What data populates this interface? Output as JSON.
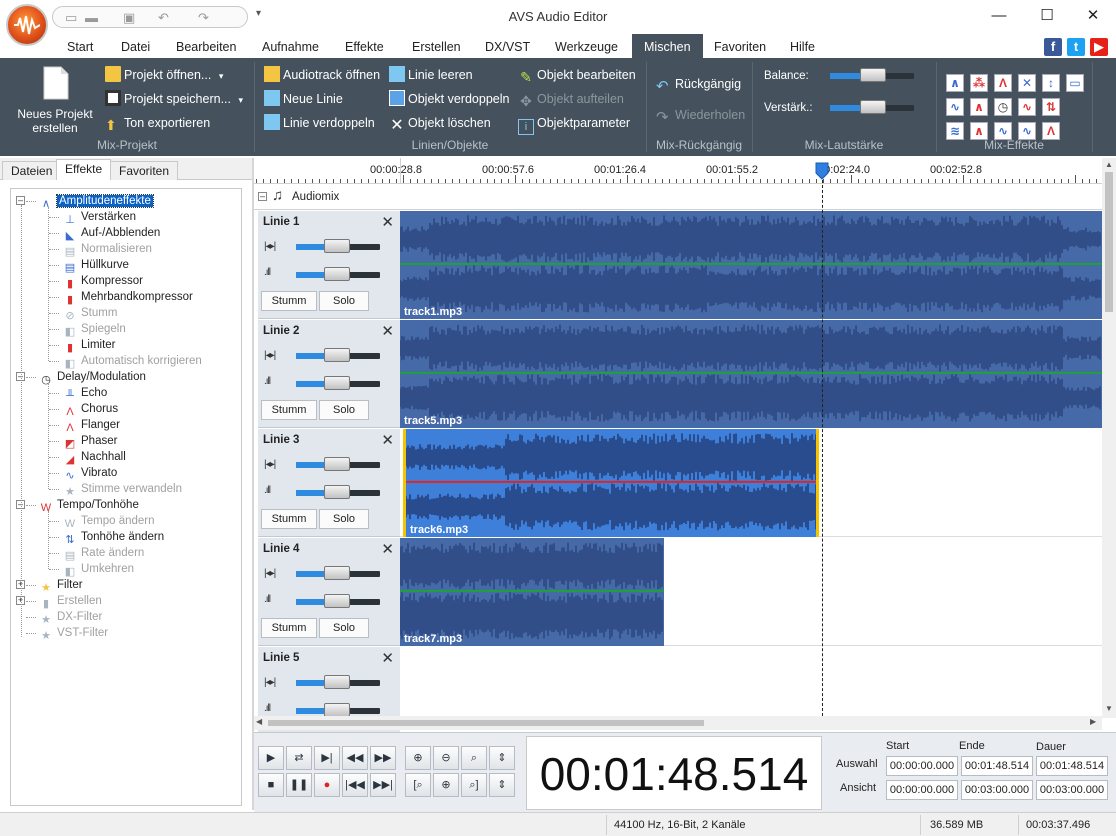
{
  "window": {
    "title": "AVS Audio Editor",
    "minimize": "—",
    "maximize": "☐",
    "close": "✕"
  },
  "menu": {
    "tabs": [
      "Start",
      "Datei",
      "Bearbeiten",
      "Aufnahme",
      "Effekte",
      "Erstellen",
      "DX/VST",
      "Werkzeuge",
      "Mischen",
      "Favoriten",
      "Hilfe"
    ],
    "active": "Mischen"
  },
  "ribbon": {
    "mix_projekt": {
      "label": "Mix-Projekt",
      "new_project": "Neues Projekt erstellen",
      "open_project": "Projekt öffnen...",
      "save_project": "Projekt speichern...",
      "export_sound": "Ton exportieren"
    },
    "lines_objects": {
      "label": "Linien/Objekte",
      "open_audiotrack": "Audiotrack öffnen",
      "new_line": "Neue Linie",
      "duplicate_line": "Linie verdoppeln",
      "clear_line": "Linie leeren",
      "duplicate_object": "Objekt verdoppeln",
      "delete_object": "Objekt löschen",
      "edit_object": "Objekt bearbeiten",
      "split_object": "Objekt aufteilen",
      "object_params": "Objektparameter"
    },
    "mix_undo": {
      "label": "Mix-Rückgängig",
      "undo": "Rückgängig",
      "redo": "Wiederholen"
    },
    "mix_volume": {
      "label": "Mix-Lautstärke",
      "balance": "Balance:",
      "gain": "Verstärk.:"
    },
    "mix_effects": {
      "label": "Mix-Effekte"
    }
  },
  "left_panel": {
    "tabs": [
      "Dateien",
      "Effekte",
      "Favoriten"
    ],
    "active_tab": "Effekte",
    "tree": [
      {
        "label": "Amplitudeneffekte",
        "level": 0,
        "expanded": true,
        "selected": true,
        "disabled": false
      },
      {
        "label": "Verstärken",
        "level": 1,
        "disabled": false
      },
      {
        "label": "Auf-/Abblenden",
        "level": 1,
        "disabled": false
      },
      {
        "label": "Normalisieren",
        "level": 1,
        "disabled": true
      },
      {
        "label": "Hüllkurve",
        "level": 1,
        "disabled": false
      },
      {
        "label": "Kompressor",
        "level": 1,
        "disabled": false
      },
      {
        "label": "Mehrbandkompressor",
        "level": 1,
        "disabled": false
      },
      {
        "label": "Stumm",
        "level": 1,
        "disabled": true
      },
      {
        "label": "Spiegeln",
        "level": 1,
        "disabled": true
      },
      {
        "label": "Limiter",
        "level": 1,
        "disabled": false
      },
      {
        "label": "Automatisch korrigieren",
        "level": 1,
        "disabled": true
      },
      {
        "label": "Delay/Modulation",
        "level": 0,
        "expanded": true,
        "disabled": false
      },
      {
        "label": "Echo",
        "level": 1,
        "disabled": false
      },
      {
        "label": "Chorus",
        "level": 1,
        "disabled": false
      },
      {
        "label": "Flanger",
        "level": 1,
        "disabled": false
      },
      {
        "label": "Phaser",
        "level": 1,
        "disabled": false
      },
      {
        "label": "Nachhall",
        "level": 1,
        "disabled": false
      },
      {
        "label": "Vibrato",
        "level": 1,
        "disabled": false
      },
      {
        "label": "Stimme verwandeln",
        "level": 1,
        "disabled": true
      },
      {
        "label": "Tempo/Tonhöhe",
        "level": 0,
        "expanded": true,
        "disabled": false
      },
      {
        "label": "Tempo ändern",
        "level": 1,
        "disabled": true
      },
      {
        "label": "Tonhöhe ändern",
        "level": 1,
        "disabled": false
      },
      {
        "label": "Rate ändern",
        "level": 1,
        "disabled": true
      },
      {
        "label": "Umkehren",
        "level": 1,
        "disabled": true
      },
      {
        "label": "Filter",
        "level": 0,
        "expanded": false,
        "disabled": false
      },
      {
        "label": "Erstellen",
        "level": 0,
        "expanded": false,
        "disabled": true
      },
      {
        "label": "DX-Filter",
        "level": 0,
        "disabled": true
      },
      {
        "label": "VST-Filter",
        "level": 0,
        "disabled": true
      }
    ]
  },
  "timeline": {
    "ticks": [
      "00:00:28.8",
      "00:00:57.6",
      "00:01:26.4",
      "00:01:55.2",
      "00:02:24.0",
      "00:02:52.8"
    ],
    "root_label": "Audiomix"
  },
  "lines": [
    {
      "title": "Linie 1",
      "mute": "Stumm",
      "solo": "Solo",
      "clip": "track1.mp3",
      "clip_start": 0.0,
      "clip_end": 1.0,
      "selected": false
    },
    {
      "title": "Linie 2",
      "mute": "Stumm",
      "solo": "Solo",
      "clip": "track5.mp3",
      "clip_start": 0.0,
      "clip_end": 1.0,
      "selected": false
    },
    {
      "title": "Linie 3",
      "mute": "Stumm",
      "solo": "Solo",
      "clip": "track6.mp3",
      "clip_start": 0.004,
      "clip_end": 0.597,
      "selected": true
    },
    {
      "title": "Linie 4",
      "mute": "Stumm",
      "solo": "Solo",
      "clip": "track7.mp3",
      "clip_start": 0.0,
      "clip_end": 0.376,
      "selected": false
    },
    {
      "title": "Linie 5",
      "mute": "Stumm",
      "solo": "Solo",
      "clip": "",
      "selected": false
    }
  ],
  "transport": {
    "time": "00:01:48.514"
  },
  "selection": {
    "headers": [
      "Start",
      "Ende",
      "Dauer"
    ],
    "rows": [
      {
        "label": "Auswahl",
        "values": [
          "00:00:00.000",
          "00:01:48.514",
          "00:01:48.514"
        ]
      },
      {
        "label": "Ansicht",
        "values": [
          "00:00:00.000",
          "00:03:00.000",
          "00:03:00.000"
        ]
      }
    ]
  },
  "status": {
    "format": "44100 Hz, 16-Bit, 2 Kanäle",
    "size": "36.589 MB",
    "duration": "00:03:37.496"
  },
  "colors": {
    "ribbon_bg": "#45515c",
    "clip_bg": "#3b4f85",
    "clip_selected": "#3d7fd9",
    "accent": "#0a62c7"
  }
}
